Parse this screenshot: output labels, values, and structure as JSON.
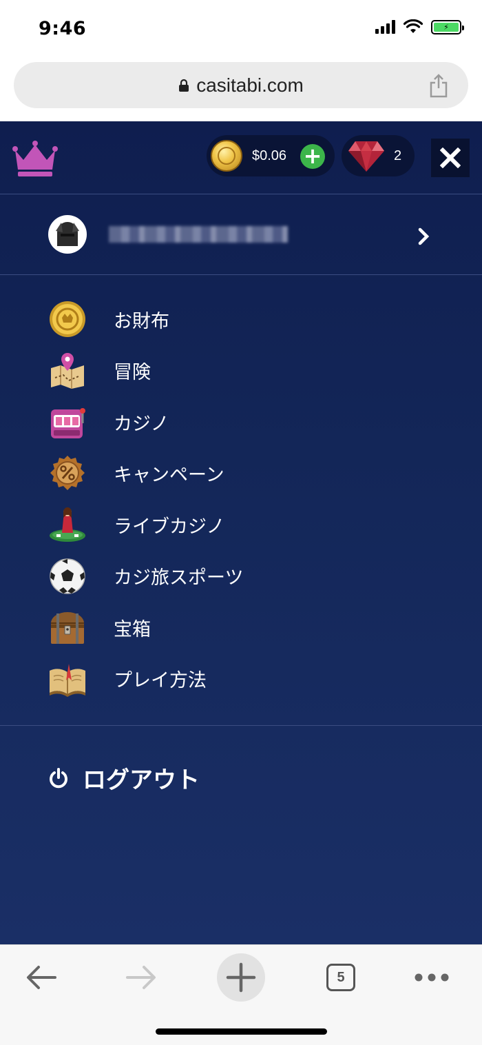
{
  "status_bar": {
    "time": "9:46"
  },
  "browser": {
    "url": "casitabi.com",
    "tab_count": "5"
  },
  "header": {
    "balance": "$0.06",
    "gems": "2"
  },
  "profile": {
    "username": "████████████"
  },
  "menu": {
    "items": [
      {
        "label": "お財布",
        "icon": "wallet-coin-icon"
      },
      {
        "label": "冒険",
        "icon": "adventure-map-icon"
      },
      {
        "label": "カジノ",
        "icon": "casino-slot-icon"
      },
      {
        "label": "キャンペーン",
        "icon": "campaign-percent-icon"
      },
      {
        "label": "ライブカジノ",
        "icon": "live-dealer-icon"
      },
      {
        "label": "カジ旅スポーツ",
        "icon": "soccer-ball-icon"
      },
      {
        "label": "宝箱",
        "icon": "treasure-chest-icon"
      },
      {
        "label": "プレイ方法",
        "icon": "book-icon"
      }
    ]
  },
  "logout": {
    "label": "ログアウト"
  },
  "colors": {
    "app_bg": "#132658",
    "crown": "#c255b8",
    "plus_green": "#3cb54a",
    "gem_red": "#c0283a"
  }
}
